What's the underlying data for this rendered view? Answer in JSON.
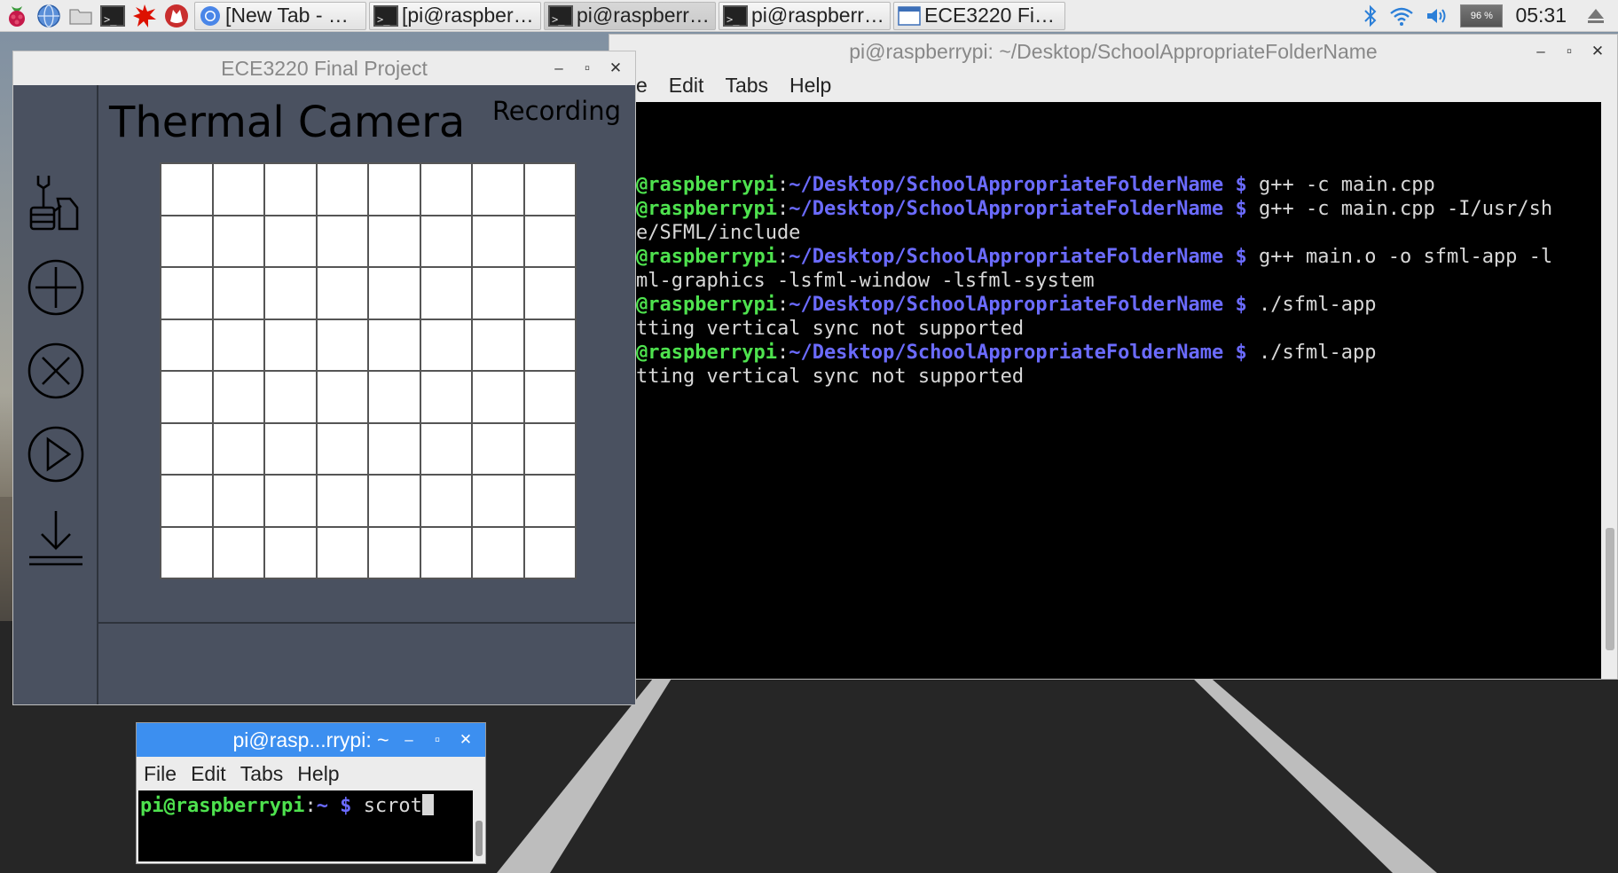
{
  "taskbar": {
    "tasks": [
      {
        "label": "[New Tab - Ch...",
        "icon": "chromium-icon"
      },
      {
        "label": "[pi@raspberry...",
        "icon": "terminal-icon"
      },
      {
        "label": "pi@raspberry...",
        "icon": "terminal-icon"
      },
      {
        "label": "pi@raspberry...",
        "icon": "terminal-icon"
      },
      {
        "label": "ECE3220 Fina...",
        "icon": "app-window-icon"
      }
    ],
    "cpu": "96 %",
    "clock": "05:31"
  },
  "big_terminal": {
    "title": "pi@raspberrypi: ~/Desktop/SchoolAppropriateFolderName",
    "menu": [
      "e",
      "Edit",
      "Tabs",
      "Help"
    ],
    "lines": [
      {
        "user": "@raspberrypi",
        "sep": ":",
        "path": "~/Desktop/SchoolAppropriateFolderName",
        "dollar": " $ ",
        "cmd": "g++ -c main.cpp"
      },
      {
        "user": "@raspberrypi",
        "sep": ":",
        "path": "~/Desktop/SchoolAppropriateFolderName",
        "dollar": " $ ",
        "cmd": "g++ -c main.cpp -I/usr/sh"
      },
      {
        "text": "e/SFML/include"
      },
      {
        "user": "@raspberrypi",
        "sep": ":",
        "path": "~/Desktop/SchoolAppropriateFolderName",
        "dollar": " $ ",
        "cmd": "g++ main.o -o sfml-app -l"
      },
      {
        "text": "ml-graphics -lsfml-window -lsfml-system"
      },
      {
        "user": "@raspberrypi",
        "sep": ":",
        "path": "~/Desktop/SchoolAppropriateFolderName",
        "dollar": " $ ",
        "cmd": "./sfml-app"
      },
      {
        "text": "tting vertical sync not supported"
      },
      {
        "user": "@raspberrypi",
        "sep": ":",
        "path": "~/Desktop/SchoolAppropriateFolderName",
        "dollar": " $ ",
        "cmd": "./sfml-app"
      },
      {
        "text": "tting vertical sync not supported"
      }
    ]
  },
  "thermal_app": {
    "window_title": "ECE3220 Final Project",
    "title": "Thermal Camera",
    "status": "Recording",
    "grid_rows": 8,
    "grid_cols": 8,
    "sidebar_buttons": [
      "settings-icon",
      "plus-icon",
      "close-circle-icon",
      "play-icon",
      "download-icon"
    ]
  },
  "small_terminal": {
    "title": "pi@rasp...rrypi: ~",
    "menu": [
      "File",
      "Edit",
      "Tabs",
      "Help"
    ],
    "prompt_user": "pi@raspberrypi",
    "prompt_sep": ":",
    "prompt_path": "~",
    "prompt_dollar": " $ ",
    "command": "scrot"
  }
}
